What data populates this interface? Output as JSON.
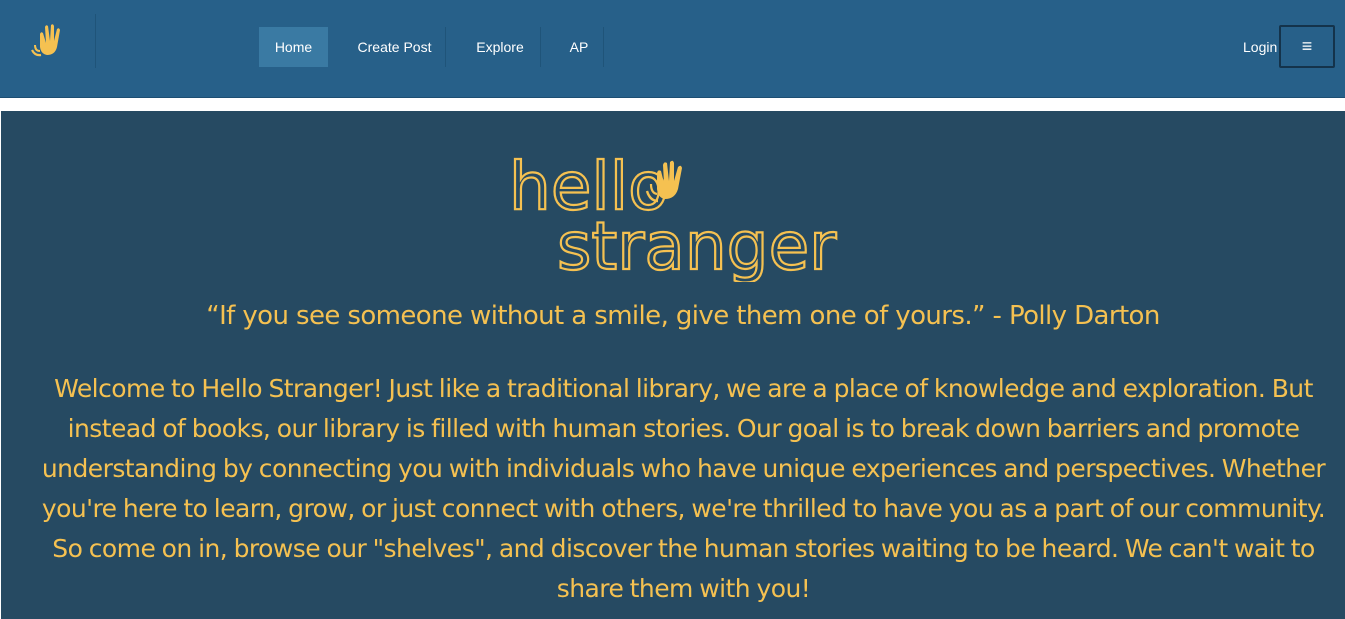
{
  "navbar": {
    "logo_icon": "waving-hand-icon",
    "items": [
      {
        "label": "Home",
        "active": true
      },
      {
        "label": "Create Post",
        "active": false
      },
      {
        "label": "Explore",
        "active": false
      },
      {
        "label": "AP",
        "active": false
      }
    ],
    "login_label": "Login",
    "menu_icon": "hamburger-menu-icon"
  },
  "hero": {
    "logo": {
      "line1": "hello",
      "line2": "stranger"
    },
    "quote": "“If you see someone without a smile, give them one of yours.” - Polly Darton",
    "welcome_text": "Welcome to Hello Stranger! Just like a traditional library, we are a place of knowledge and exploration. But instead of books, our library is filled with human stories. Our goal is to break down barriers and promote understanding by connecting you with individuals who have unique experiences and perspectives. Whether you're here to learn, grow, or just connect with others, we're thrilled to have you as a part of our community. So come on in, browse our \"shelves\", and discover the human stories waiting to be heard. We can't wait to share them with you!"
  },
  "colors": {
    "navbar": "#276089",
    "hero_background": "#264a62",
    "accent": "#f5c151",
    "active_tab": "#3a7aa3"
  }
}
